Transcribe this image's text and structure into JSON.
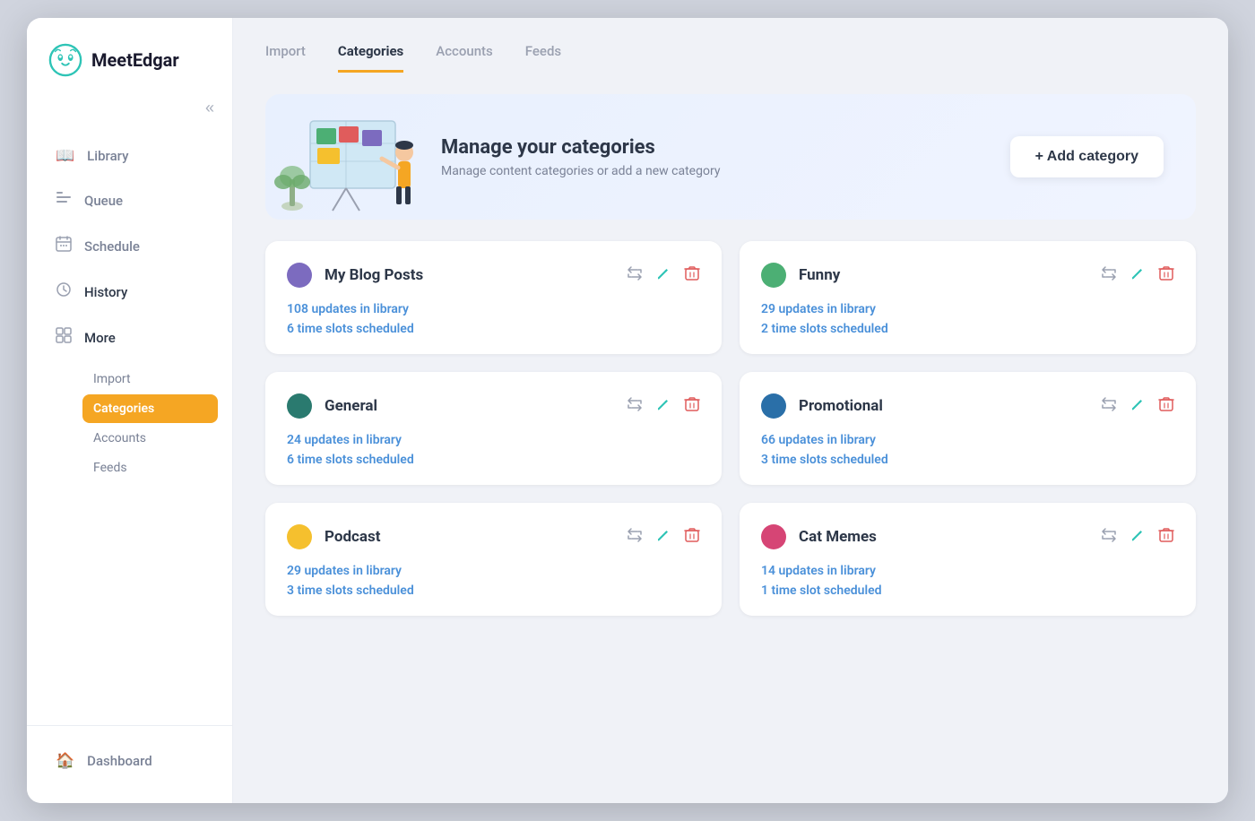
{
  "app": {
    "name": "MeetEdgar"
  },
  "sidebar": {
    "collapse_label": "«",
    "nav_items": [
      {
        "id": "library",
        "label": "Library",
        "icon": "📖"
      },
      {
        "id": "queue",
        "label": "Queue",
        "icon": "☰"
      },
      {
        "id": "schedule",
        "label": "Schedule",
        "icon": "📅"
      },
      {
        "id": "history",
        "label": "History",
        "icon": "🕐"
      },
      {
        "id": "more",
        "label": "More",
        "icon": "⊞"
      }
    ],
    "sub_items": [
      {
        "id": "import",
        "label": "Import",
        "active": false
      },
      {
        "id": "categories",
        "label": "Categories",
        "active": true
      },
      {
        "id": "accounts",
        "label": "Accounts",
        "active": false
      },
      {
        "id": "feeds",
        "label": "Feeds",
        "active": false
      }
    ],
    "bottom_items": [
      {
        "id": "dashboard",
        "label": "Dashboard",
        "icon": "🏠"
      }
    ]
  },
  "tabs": [
    {
      "id": "import",
      "label": "Import",
      "active": false
    },
    {
      "id": "categories",
      "label": "Categories",
      "active": true
    },
    {
      "id": "accounts",
      "label": "Accounts",
      "active": false
    },
    {
      "id": "feeds",
      "label": "Feeds",
      "active": false
    }
  ],
  "hero": {
    "title": "Manage your categories",
    "subtitle": "Manage content categories or add a new category",
    "add_button": "+ Add category"
  },
  "categories": [
    {
      "id": "my-blog-posts",
      "name": "My Blog Posts",
      "color": "#7c6bbf",
      "updates": "108 updates in library",
      "slots": "6 time slots scheduled"
    },
    {
      "id": "funny",
      "name": "Funny",
      "color": "#4caf74",
      "updates": "29 updates in library",
      "slots": "2 time slots scheduled"
    },
    {
      "id": "general",
      "name": "General",
      "color": "#2a7a6f",
      "updates": "24 updates in library",
      "slots": "6 time slots scheduled"
    },
    {
      "id": "promotional",
      "name": "Promotional",
      "color": "#2a6fa8",
      "updates": "66 updates in library",
      "slots": "3 time slots scheduled"
    },
    {
      "id": "podcast",
      "name": "Podcast",
      "color": "#f5c02e",
      "updates": "29 updates in library",
      "slots": "3 time slots scheduled"
    },
    {
      "id": "cat-memes",
      "name": "Cat Memes",
      "color": "#d64575",
      "updates": "14 updates in library",
      "slots": "1 time slot scheduled"
    }
  ]
}
